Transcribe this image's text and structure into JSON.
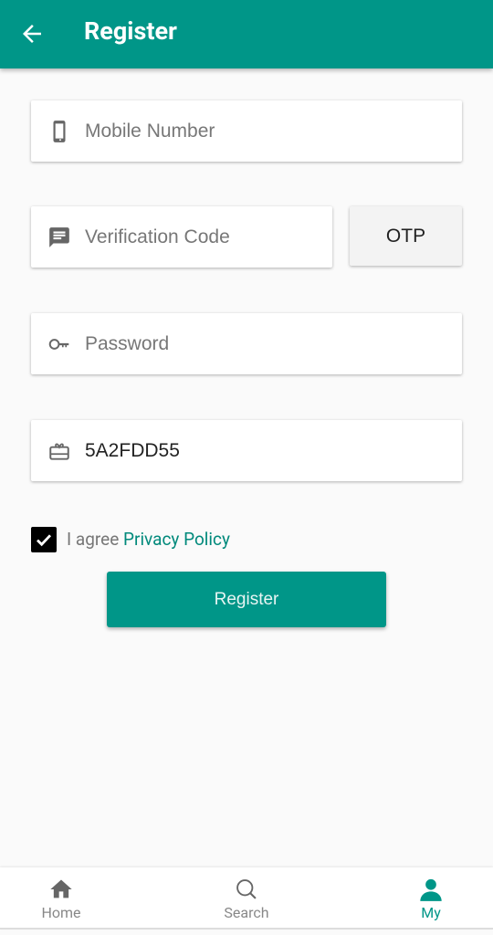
{
  "header": {
    "title": "Register",
    "back_icon": "arrow-left-icon"
  },
  "form": {
    "mobile": {
      "placeholder": "Mobile Number",
      "value": "",
      "icon": "phone-icon"
    },
    "code": {
      "placeholder": "Verification Code",
      "value": "",
      "icon": "message-icon"
    },
    "otp_label": "OTP",
    "password": {
      "placeholder": "Password",
      "value": "",
      "icon": "key-icon"
    },
    "invite": {
      "value": "5A2FDD55",
      "icon": "gift-card-icon"
    },
    "agree_checked": true,
    "agree_text": "I agree ",
    "privacy_link": "Privacy Policy",
    "submit_label": "Register"
  },
  "nav": {
    "items": [
      {
        "label": "Home",
        "icon": "home-icon"
      },
      {
        "label": "Search",
        "icon": "search-icon"
      },
      {
        "label": "My",
        "icon": "person-icon",
        "active": true
      }
    ]
  },
  "colors": {
    "primary": "#009688",
    "background": "#fafafa"
  }
}
